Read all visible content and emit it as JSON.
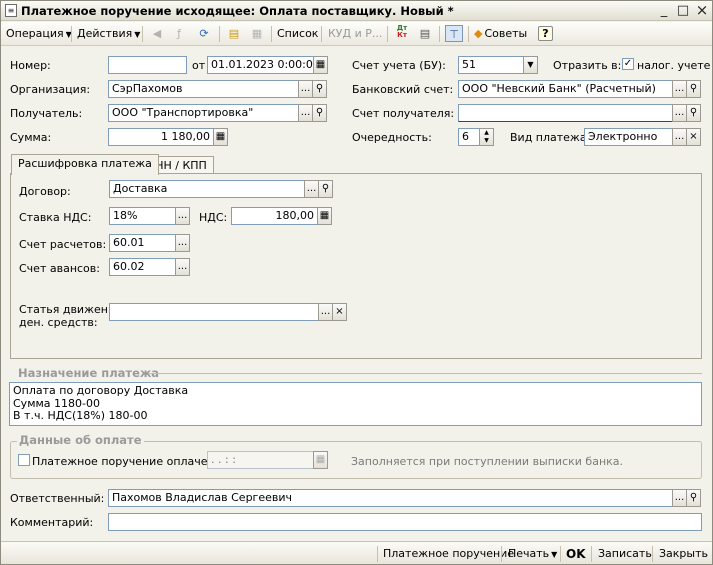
{
  "window": {
    "title": "Платежное поручение исходящее: Оплата поставщику. Новый *",
    "controls": {
      "minimize": "_",
      "maximize": "□",
      "close": "×"
    }
  },
  "toolbar": {
    "operation": "Операция",
    "actions": "Действия",
    "list": "Список",
    "kudir": "КУД и Р...",
    "dt_kt_top": "Дт",
    "dt_kt_bottom": "Кт",
    "advice": "Советы",
    "help": "?"
  },
  "form": {
    "number_label": "Номер:",
    "number_value": "",
    "date_label": "от",
    "date_value": "01.01.2023  0:00:00",
    "account_bu_label": "Счет учета (БУ):",
    "account_bu_value": "51",
    "reflect_label": "Отразить в:",
    "tax_label": "налог. учете",
    "tax_checked": "✓",
    "org_label": "Организация:",
    "org_value": "СэрПахомов",
    "bank_account_label": "Банковский счет:",
    "bank_account_value": "ООО \"Невский Банк\" (Расчетный)",
    "recipient_label": "Получатель:",
    "recipient_value": "ООО \"Транспортировка\"",
    "recipient_account_label": "Счет получателя:",
    "recipient_account_value": "",
    "sum_label": "Сумма:",
    "sum_value": "1 180,00",
    "priority_label": "Очередность:",
    "priority_value": "6",
    "payment_type_label": "Вид платежа:",
    "payment_type_value": "Электронно"
  },
  "tabs": [
    {
      "label": "Расшифровка платежа",
      "active": true
    },
    {
      "label": "ИНН / КПП",
      "active": false
    }
  ],
  "breakdown": {
    "contract_label": "Договор:",
    "contract_value": "Доставка",
    "vat_rate_label": "Ставка НДС:",
    "vat_rate_value": "18%",
    "vat_label": "НДС:",
    "vat_value": "180,00",
    "settlement_label": "Счет расчетов:",
    "settlement_value": "60.01",
    "advance_label": "Счет авансов:",
    "advance_value": "60.02",
    "cashflow_label_1": "Статья движения",
    "cashflow_label_2": "ден. средств:",
    "cashflow_value": ""
  },
  "purpose": {
    "title": "Назначение платежа",
    "lines": [
      "Оплата по договору Доставка",
      "Сумма 1180-00",
      "В т.ч. НДС(18%) 180-00"
    ]
  },
  "payment": {
    "title": "Данные об оплате",
    "paid_label": "Платежное поручение оплачено:",
    "paid_date": " .  .      :  :",
    "hint": "Заполняется при поступлении выписки банка."
  },
  "footer_fields": {
    "responsible_label": "Ответственный:",
    "responsible_value": "Пахомов Владислав Сергеевич",
    "comment_label": "Комментарий:",
    "comment_value": ""
  },
  "bottom": {
    "payment_order": "Платежное поручение",
    "print": "Печать",
    "ok": "OK",
    "save": "Записать",
    "close": "Закрыть"
  },
  "icons": {
    "select": "...",
    "search": "magnifier-icon",
    "calendar": "calendar-icon",
    "calculator": "calculator-icon",
    "clear": "×"
  },
  "colors": {
    "field_border": "#7f9db9",
    "required_underline": "#e00000",
    "section_title": "#9a9a9a"
  }
}
